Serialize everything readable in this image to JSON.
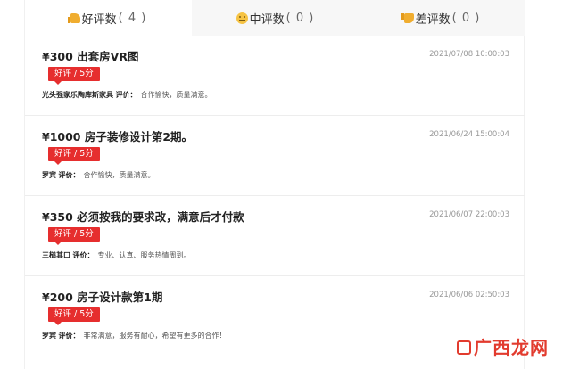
{
  "tabs": [
    {
      "icon": "thumbs-up-icon",
      "label": "好评数",
      "count": "( 4 )",
      "active": true
    },
    {
      "icon": "neutral-face-icon",
      "label": "中评数",
      "count": "( 0 )",
      "active": false
    },
    {
      "icon": "thumbs-down-icon",
      "label": "差评数",
      "count": "( 0 )",
      "active": false
    }
  ],
  "reviews": [
    {
      "title": "¥300 出套房VR图",
      "date": "2021/07/08 10:00:03",
      "badge": "好评 / 5分",
      "reviewer": "光头强家乐陶库斯家具",
      "label": "评价：",
      "text": "合作愉快，质量满意。"
    },
    {
      "title": "¥1000 房子装修设计第2期。",
      "date": "2021/06/24 15:00:04",
      "badge": "好评 / 5分",
      "reviewer": "罗宾",
      "label": "评价：",
      "text": "合作愉快，质量满意。"
    },
    {
      "title": "¥350 必须按我的要求改，满意后才付款",
      "date": "2021/06/07 22:00:03",
      "badge": "好评 / 5分",
      "reviewer": "三槌其口",
      "label": "评价：",
      "text": "专业、认真、服务热情周到。"
    },
    {
      "title": "¥200 房子设计款第1期",
      "date": "2021/06/06 02:50:03",
      "badge": "好评 / 5分",
      "reviewer": "罗宾",
      "label": "评价：",
      "text": "非常满意，服务有耐心，希望有更多的合作！"
    }
  ],
  "watermark": {
    "text": "广西龙网"
  }
}
